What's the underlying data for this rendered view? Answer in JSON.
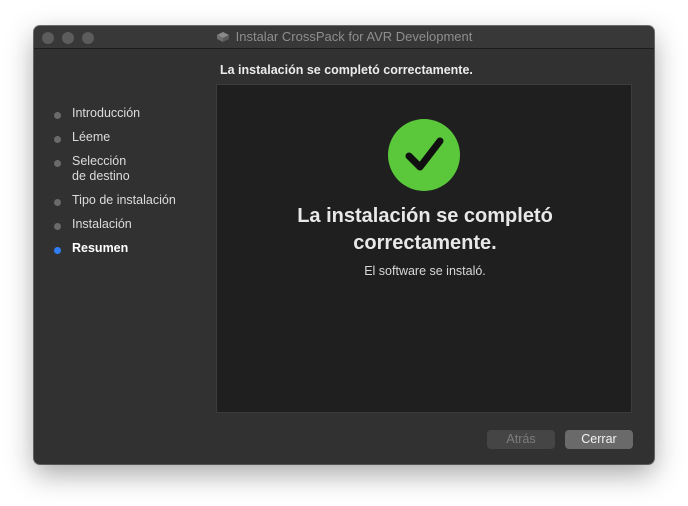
{
  "window": {
    "title": "Instalar CrossPack for AVR Development"
  },
  "header": {
    "heading": "La instalación se completó correctamente."
  },
  "sidebar": {
    "steps": [
      {
        "label": "Introducción"
      },
      {
        "label": "Léeme"
      },
      {
        "label": "Selección de destino",
        "line1": "Selección",
        "line2": "de destino"
      },
      {
        "label": "Tipo de instalación"
      },
      {
        "label": "Instalación"
      },
      {
        "label": "Resumen",
        "active": true
      }
    ]
  },
  "main": {
    "headline_line1": "La instalación se completó",
    "headline_line2": "correctamente.",
    "message": "El software se instaló.",
    "status_icon": "checkmark-circle-icon",
    "status_color": "#5ac83a"
  },
  "buttons": {
    "back_label": "Atrás",
    "close_label": "Cerrar"
  },
  "colors": {
    "window_bg": "#313131",
    "panel_bg": "#1f1f1f",
    "active_step_dot": "#2f7ef7"
  }
}
